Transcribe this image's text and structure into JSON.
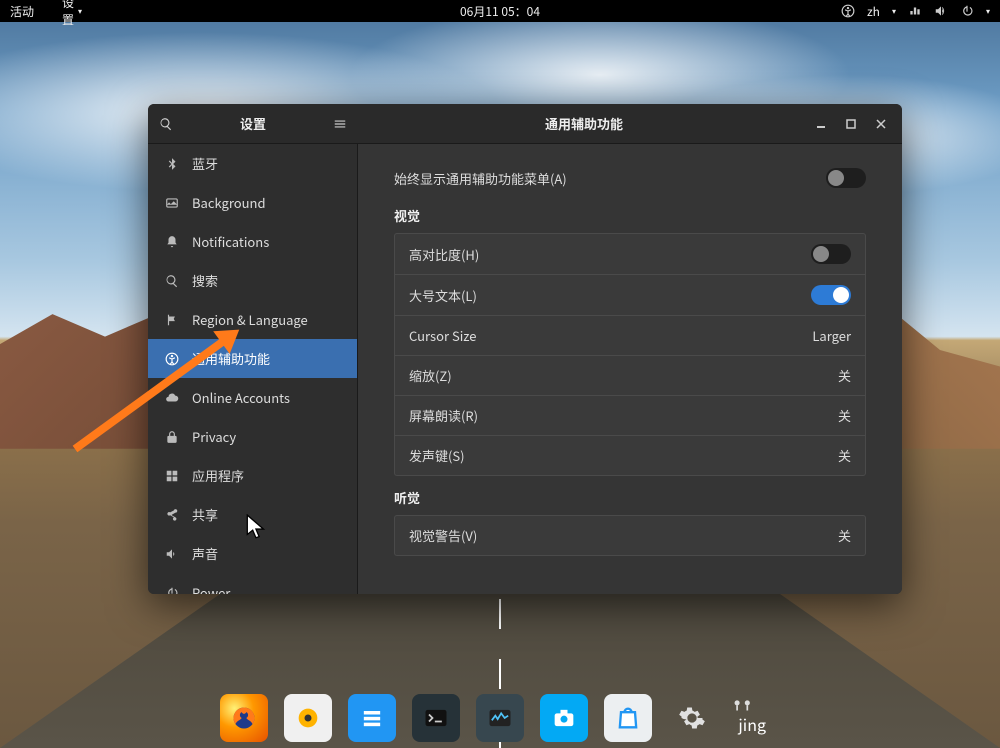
{
  "topbar": {
    "activities": "活动",
    "settings": "设置",
    "clock": "06月11 05：04",
    "lang": "zh"
  },
  "window": {
    "sidebar_title": "设置",
    "content_title": "通用辅助功能"
  },
  "sidebar": {
    "items": [
      {
        "label": "蓝牙"
      },
      {
        "label": "Background"
      },
      {
        "label": "Notifications"
      },
      {
        "label": "搜索"
      },
      {
        "label": "Region & Language"
      },
      {
        "label": "通用辅助功能"
      },
      {
        "label": "Online Accounts"
      },
      {
        "label": "Privacy"
      },
      {
        "label": "应用程序"
      },
      {
        "label": "共享"
      },
      {
        "label": "声音"
      },
      {
        "label": "Power"
      }
    ]
  },
  "content": {
    "always_show": "始终显示通用辅助功能菜单(A)",
    "section_vision": "视觉",
    "vision": {
      "high_contrast": {
        "label": "高对比度(H)"
      },
      "large_text": {
        "label": "大号文本(L)"
      },
      "cursor_size": {
        "label": "Cursor Size",
        "value": "Larger"
      },
      "zoom": {
        "label": "缩放(Z)",
        "value": "关"
      },
      "screen_reader": {
        "label": "屏幕朗读(R)",
        "value": "关"
      },
      "sound_keys": {
        "label": "发声键(S)",
        "value": "关"
      }
    },
    "section_hearing": "听觉",
    "hearing": {
      "visual_alert": {
        "label": "视觉警告(V)",
        "value": "关"
      }
    }
  },
  "dock": {
    "jing_label": "jing"
  }
}
